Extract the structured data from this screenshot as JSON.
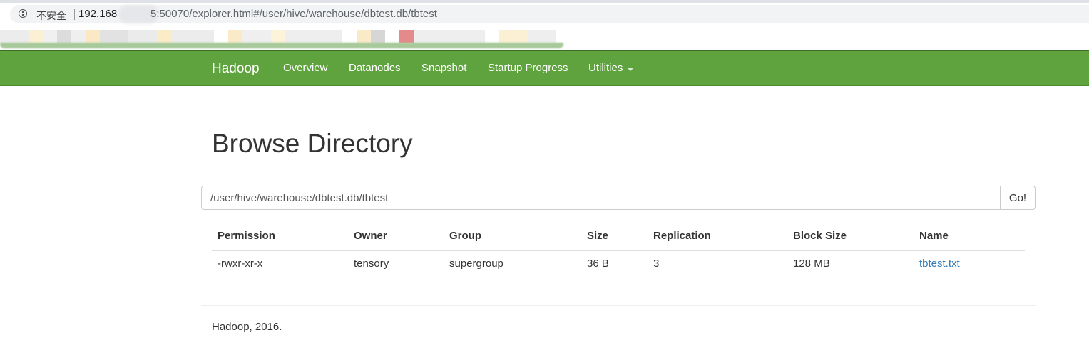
{
  "browser": {
    "security_label": "不安全",
    "url_host_visible": "192.168",
    "url_rest": "5:50070/explorer.html#/user/hive/warehouse/dbtest.db/tbtest"
  },
  "navbar": {
    "brand": "Hadoop",
    "links": [
      "Overview",
      "Datanodes",
      "Snapshot",
      "Startup Progress",
      "Utilities"
    ],
    "color": "#5fa33e"
  },
  "page": {
    "title": "Browse Directory"
  },
  "path_form": {
    "path_value": "/user/hive/warehouse/dbtest.db/tbtest",
    "go_label": "Go!"
  },
  "table": {
    "headers": [
      "Permission",
      "Owner",
      "Group",
      "Size",
      "Replication",
      "Block Size",
      "Name"
    ],
    "rows": [
      [
        "-rwxr-xr-x",
        "tensory",
        "supergroup",
        "36 B",
        "3",
        "128 MB",
        "tbtest.txt"
      ]
    ],
    "link_color": "#337ab7"
  },
  "footer": {
    "text": "Hadoop, 2016."
  }
}
